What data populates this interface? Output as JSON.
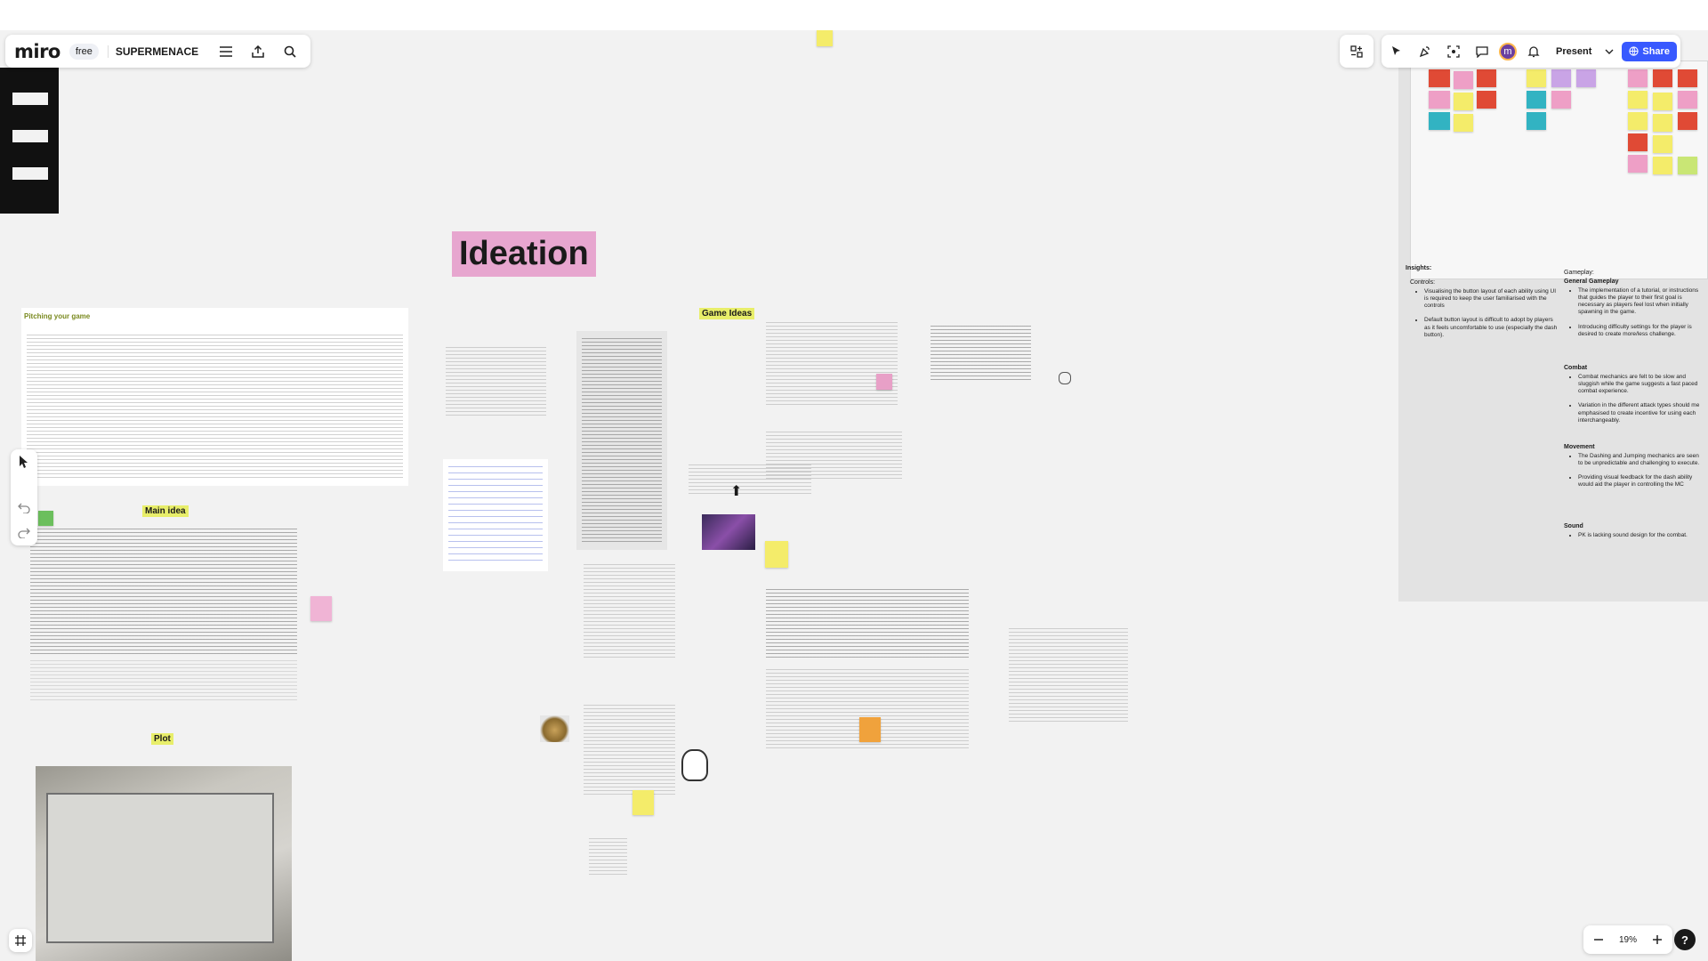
{
  "app": {
    "logo": "miro",
    "plan": "free",
    "board_name": "SUPERMENACE",
    "present_label": "Present",
    "share_label": "Share",
    "avatar_initial": "m",
    "zoom": "19%"
  },
  "board": {
    "ideation_title": "Ideation",
    "game_ideas_label": "Game Ideas",
    "main_idea_label": "Main idea",
    "plot_label": "Plot",
    "pitch_title": "Pitching your game"
  },
  "insights": {
    "title": "Insights:",
    "controls": {
      "heading": "Controls:",
      "items": [
        "Visualising the button layout of each ability using UI is required to keep the user familiarised with the controls",
        "Default button layout is difficult to adopt by players as it feels uncomfortable to use (especially the dash button)."
      ]
    },
    "gameplay": {
      "heading": "Gameplay:",
      "subheading": "General Gameplay",
      "items": [
        "The implementation of a tutorial, or instructions that guides the player to their first goal is necessary as players feel lost when initially spawning in the game.",
        "Introducing difficulty settings for the player is desired to create more/less challenge."
      ]
    },
    "combat": {
      "heading": "Combat",
      "items": [
        "Combat mechanics are felt to be slow and sluggish while the game suggests a fast paced combat experience.",
        "Variation in the different attack types should me emphasised to create incentive for using each interchangeably."
      ]
    },
    "movement": {
      "heading": "Movement",
      "items": [
        "The Dashing and Jumping mechanics are seen to be unpredictable and challenging to execute.",
        "Providing visual feedback for the dash ability would aid the player in controlling the MC"
      ]
    },
    "sound": {
      "heading": "Sound",
      "items": [
        "PK is lacking sound design for the combat."
      ]
    }
  },
  "colors": {
    "accent": "#3859ff",
    "ideation_bg": "#e7a6cf",
    "highlight": "#e8ee6a",
    "canvas": "#f2f2f2"
  },
  "icons": {
    "menu": "hamburger-icon",
    "export": "upload-icon",
    "search": "search-icon",
    "apps": "apps-icon",
    "cursor": "cursor-icon",
    "undo": "undo-icon",
    "redo": "redo-icon"
  }
}
